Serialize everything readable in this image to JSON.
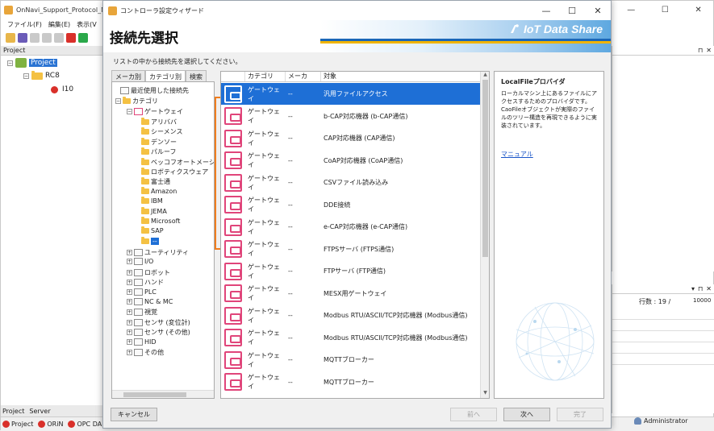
{
  "bg_app": {
    "title": "OnNavi_Support_Protocol_M",
    "menu": [
      "ファイル(F)",
      "編集(E)",
      "表示(V"
    ],
    "project_header": "Project",
    "tree": {
      "root": "Project",
      "child": "RC8",
      "leaf": "I10"
    },
    "bottom_tabs": [
      "Project",
      "Server"
    ],
    "status_items": [
      "Project",
      "ORiN",
      "OPC DA"
    ],
    "row_count_label": "行数 : 19 /",
    "row_count_max": "10000",
    "user": "Administrator"
  },
  "dialog": {
    "title": "コントローラ設定ウィザード",
    "heading": "接続先選択",
    "logo_text": "IoT Data Share",
    "instruction": "リストの中から接続先を選択してください。",
    "left_tabs": [
      "メーカ別",
      "カテゴリ別",
      "検索"
    ],
    "tree": {
      "recent": "最近使用した接続先",
      "category": "カテゴリ",
      "gateway": "ゲートウェイ",
      "gateway_children": [
        "アリババ",
        "シーメンス",
        "デンソー",
        "パルーフ",
        "ベッコフオートメーション",
        "ロボティクスウェア",
        "富士通",
        "Amazon",
        "IBM",
        "JEMA",
        "Microsoft",
        "SAP",
        "--"
      ],
      "other_categories": [
        "ユーティリティ",
        "I/O",
        "ロボット",
        "ハンド",
        "PLC",
        "NC & MC",
        "視覚",
        "センサ (変位計)",
        "センサ (その他)",
        "HID",
        "その他"
      ]
    },
    "list": {
      "columns": [
        "カテゴリ",
        "メーカ",
        "対象"
      ],
      "rows": [
        {
          "category": "ゲートウェイ",
          "maker": "--",
          "target": "汎用ファイルアクセス"
        },
        {
          "category": "ゲートウェイ",
          "maker": "--",
          "target": "b-CAP対応機器 (b-CAP通信)"
        },
        {
          "category": "ゲートウェイ",
          "maker": "--",
          "target": "CAP対応機器 (CAP通信)"
        },
        {
          "category": "ゲートウェイ",
          "maker": "--",
          "target": "CoAP対応機器 (CoAP通信)"
        },
        {
          "category": "ゲートウェイ",
          "maker": "--",
          "target": "CSVファイル読み込み"
        },
        {
          "category": "ゲートウェイ",
          "maker": "--",
          "target": "DDE接続"
        },
        {
          "category": "ゲートウェイ",
          "maker": "--",
          "target": "e-CAP対応機器 (e-CAP通信)"
        },
        {
          "category": "ゲートウェイ",
          "maker": "--",
          "target": "FTPSサーバ (FTPS通信)"
        },
        {
          "category": "ゲートウェイ",
          "maker": "--",
          "target": "FTPサーバ (FTP通信)"
        },
        {
          "category": "ゲートウェイ",
          "maker": "--",
          "target": "MESX用ゲートウェイ"
        },
        {
          "category": "ゲートウェイ",
          "maker": "--",
          "target": "Modbus RTU/ASCII/TCP対応機器 (Modbus通信)"
        },
        {
          "category": "ゲートウェイ",
          "maker": "--",
          "target": "Modbus RTU/ASCII/TCP対応機器 (Modbus通信)"
        },
        {
          "category": "ゲートウェイ",
          "maker": "--",
          "target": "MQTTブローカー"
        },
        {
          "category": "ゲートウェイ",
          "maker": "--",
          "target": "MQTTブローカー"
        }
      ]
    },
    "description": {
      "title": "LocalFileプロバイダ",
      "body": "ローカルマシン上にあるファイルにアクセスするためのプロバイダです。CaoFileオブジェクトが実際のファイルのツリー構造を再現できるように実装されています。",
      "link": "マニュアル"
    },
    "buttons": {
      "cancel": "キャンセル",
      "back": "前へ",
      "next": "次へ",
      "finish": "完了"
    }
  },
  "colors": {
    "accent": "#1e6fd6",
    "highlight": "#f07d1e",
    "gateway_icon": "#e0457a"
  }
}
